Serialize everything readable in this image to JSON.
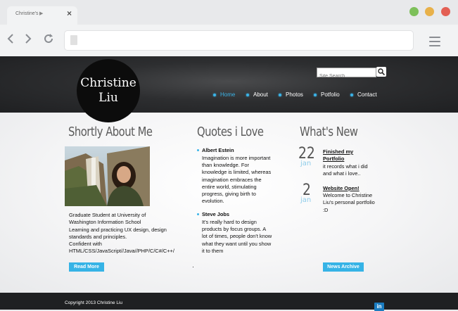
{
  "browser": {
    "tab_title": "Christine's",
    "tab_play": "▶",
    "tab_close": "×",
    "back": "‹",
    "forward": "›",
    "reload": "⟳"
  },
  "header": {
    "logo_line1": "Christine",
    "logo_line2": "Liu",
    "search_placeholder": "Site Search",
    "nav": [
      {
        "label": "Home",
        "active": true
      },
      {
        "label": "About",
        "active": false
      },
      {
        "label": "Photos",
        "active": false
      },
      {
        "label": "Potfolio",
        "active": false
      },
      {
        "label": "Contact",
        "active": false
      }
    ]
  },
  "about": {
    "title": "Shortly About Me",
    "lines": [
      "Graduate Student at University of",
      "Washington Information School",
      "Learning and practicing UX design, design",
      "standards and principles.",
      "Confident with",
      "HTML/CSS/JavaScript//Java//PHP/C/C#/C++/"
    ],
    "button": "Read More"
  },
  "quotes": {
    "title": "Quotes i Love",
    "items": [
      {
        "author": "Albert Estein",
        "text": "Imagination is more important than knowledge. For knowledge is limited, whereas imagination embraces the entire world, stimulating progress, giving birth to evolution."
      },
      {
        "author": "Steve Jobs",
        "text": "It's really hard to design products by focus groups. A lot of times, people don't know what they want until you show it to them"
      }
    ]
  },
  "news": {
    "title": "What's New",
    "items": [
      {
        "day": "22",
        "month": "jan",
        "title": "Finished my Portfolio",
        "text": "it records what i did and what i love.."
      },
      {
        "day": "2",
        "month": "jan",
        "title": "Website Open!",
        "text": "Welcome to Christine Liu's personal portfolio :D"
      }
    ],
    "button": "News Archive"
  },
  "footer": {
    "copyright": "Copyright 2013 Christine Liu",
    "social": "in"
  },
  "colors": {
    "accent": "#36b3e6",
    "header_bg": "#2d2e30",
    "footer_bg": "#1f2022"
  }
}
